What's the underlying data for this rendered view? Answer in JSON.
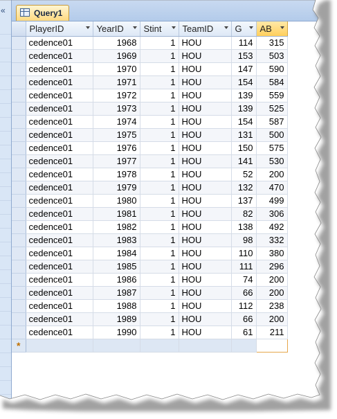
{
  "tab": {
    "label": "Query1",
    "icon": "query-icon"
  },
  "nav": {
    "collapse_glyph": "«",
    "icon": "collapse-nav-icon"
  },
  "columns": [
    {
      "key": "PlayerID",
      "label": "PlayerID"
    },
    {
      "key": "YearID",
      "label": "YearID"
    },
    {
      "key": "Stint",
      "label": "Stint"
    },
    {
      "key": "TeamID",
      "label": "TeamID"
    },
    {
      "key": "G",
      "label": "G"
    },
    {
      "key": "AB",
      "label": "AB"
    }
  ],
  "rows": [
    [
      "cedence01",
      "1968",
      "1",
      "HOU",
      "114",
      "315"
    ],
    [
      "cedence01",
      "1969",
      "1",
      "HOU",
      "153",
      "503"
    ],
    [
      "cedence01",
      "1970",
      "1",
      "HOU",
      "147",
      "590"
    ],
    [
      "cedence01",
      "1971",
      "1",
      "HOU",
      "154",
      "584"
    ],
    [
      "cedence01",
      "1972",
      "1",
      "HOU",
      "139",
      "559"
    ],
    [
      "cedence01",
      "1973",
      "1",
      "HOU",
      "139",
      "525"
    ],
    [
      "cedence01",
      "1974",
      "1",
      "HOU",
      "154",
      "587"
    ],
    [
      "cedence01",
      "1975",
      "1",
      "HOU",
      "131",
      "500"
    ],
    [
      "cedence01",
      "1976",
      "1",
      "HOU",
      "150",
      "575"
    ],
    [
      "cedence01",
      "1977",
      "1",
      "HOU",
      "141",
      "530"
    ],
    [
      "cedence01",
      "1978",
      "1",
      "HOU",
      "52",
      "200"
    ],
    [
      "cedence01",
      "1979",
      "1",
      "HOU",
      "132",
      "470"
    ],
    [
      "cedence01",
      "1980",
      "1",
      "HOU",
      "137",
      "499"
    ],
    [
      "cedence01",
      "1981",
      "1",
      "HOU",
      "82",
      "306"
    ],
    [
      "cedence01",
      "1982",
      "1",
      "HOU",
      "138",
      "492"
    ],
    [
      "cedence01",
      "1983",
      "1",
      "HOU",
      "98",
      "332"
    ],
    [
      "cedence01",
      "1984",
      "1",
      "HOU",
      "110",
      "380"
    ],
    [
      "cedence01",
      "1985",
      "1",
      "HOU",
      "111",
      "296"
    ],
    [
      "cedence01",
      "1986",
      "1",
      "HOU",
      "74",
      "200"
    ],
    [
      "cedence01",
      "1987",
      "1",
      "HOU",
      "66",
      "200"
    ],
    [
      "cedence01",
      "1988",
      "1",
      "HOU",
      "112",
      "238"
    ],
    [
      "cedence01",
      "1989",
      "1",
      "HOU",
      "66",
      "200"
    ],
    [
      "cedence01",
      "1990",
      "1",
      "HOU",
      "61",
      "211"
    ]
  ],
  "new_row_marker": "*",
  "selected_column": "AB",
  "colors": {
    "accent": "#ffcf5c",
    "header_bg": "#dde8f6",
    "selector_bg": "#dfe8f5",
    "new_record_marker": "#c07000"
  }
}
